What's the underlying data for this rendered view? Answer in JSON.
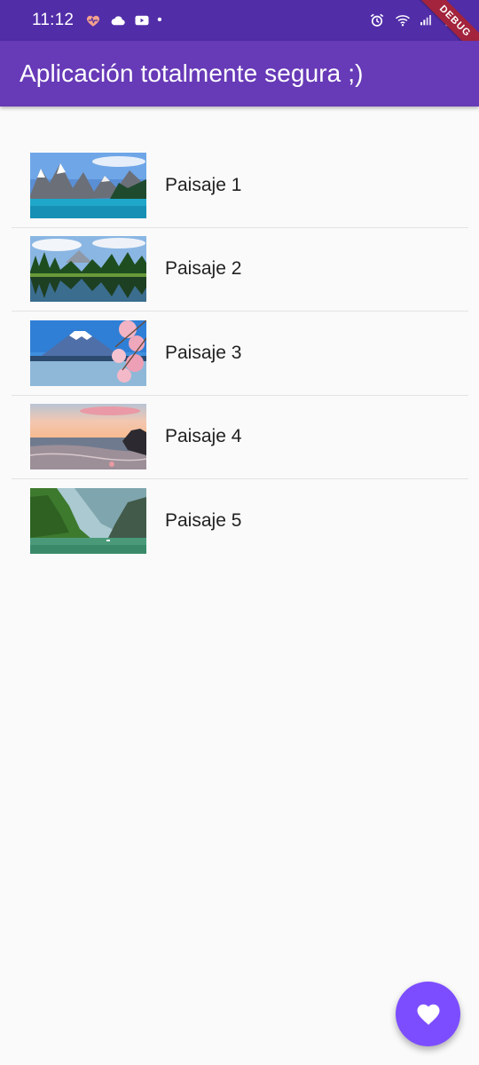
{
  "status_bar": {
    "time": "11:12",
    "dot": "•",
    "debug_label": "DEBUG",
    "icons": [
      "health-icon",
      "cloud-icon",
      "youtube-icon",
      "alarm-icon",
      "wifi-icon",
      "signal-icon",
      "battery-icon"
    ]
  },
  "app_bar": {
    "title": "Aplicación totalmente segura ;)",
    "color": "#673ab7",
    "status_color": "#512da8"
  },
  "list": {
    "items": [
      {
        "label": "Paisaje 1",
        "image": "mountain-lake"
      },
      {
        "label": "Paisaje 2",
        "image": "forest-lake"
      },
      {
        "label": "Paisaje 3",
        "image": "mount-fuji-cherry"
      },
      {
        "label": "Paisaje 4",
        "image": "beach-sunset"
      },
      {
        "label": "Paisaje 5",
        "image": "river-canyon"
      }
    ]
  },
  "fab": {
    "icon": "heart-icon",
    "color": "#7c4dff"
  }
}
